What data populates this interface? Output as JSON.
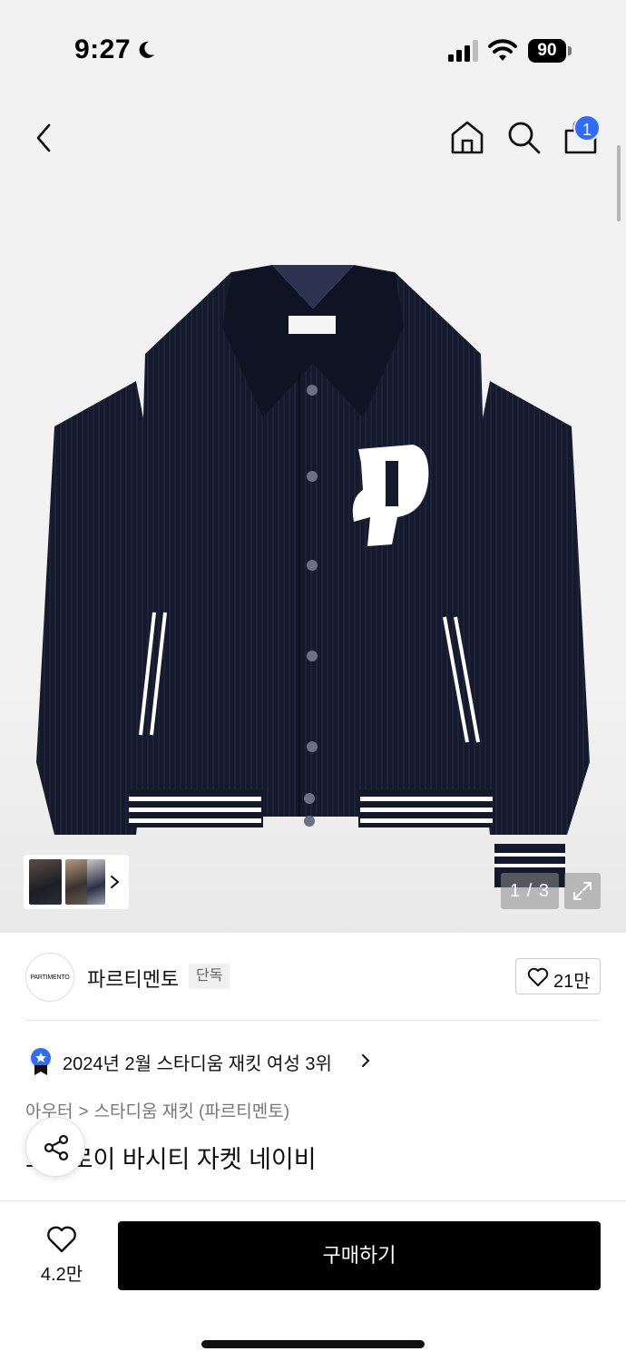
{
  "status_bar": {
    "time": "9:27",
    "battery": "90"
  },
  "header": {
    "cart_badge": "1"
  },
  "gallery": {
    "page_counter": "1 / 3"
  },
  "brand": {
    "logo_text": "PARTIMENTO",
    "name": "파르티멘토",
    "tag": "단독",
    "like_count": "21만"
  },
  "ranking": {
    "text": "2024년 2월 스타디움 재킷 여성 3위"
  },
  "breadcrumb": {
    "category": "아우터",
    "separator": ">",
    "subcategory": "스타디움 재킷 (파르티멘토)"
  },
  "product": {
    "title_visible": "코듀로이 바시티 자켓 네이비"
  },
  "bottom_bar": {
    "wish_count": "4.2만",
    "buy_label": "구매하기"
  },
  "colors": {
    "accent_blue": "#2f6bff",
    "buy_button": "#000000",
    "jacket_navy": "#141a2c"
  }
}
